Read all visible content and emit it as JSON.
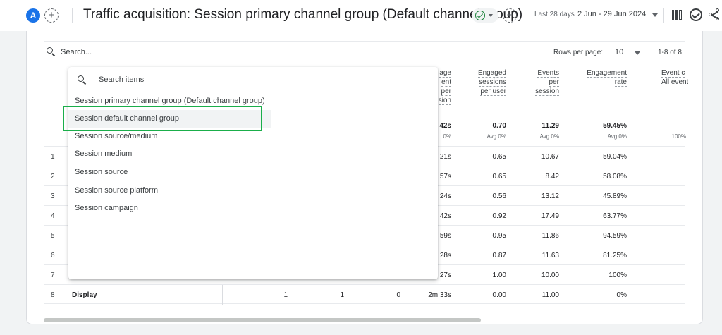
{
  "header": {
    "avatar_letter": "A",
    "title": "Traffic acquisition: Session primary channel group (Default channel group)",
    "date_label": "Last 28 days",
    "date_range": "2 Jun - 29 Jun 2024"
  },
  "table_controls": {
    "search_placeholder": "Search...",
    "rows_per_page_label": "Rows per page:",
    "rows_per_page_value": "10",
    "page_count": "1-8 of 8"
  },
  "columns": {
    "avg_engagement_time": [
      "age",
      "ent",
      "per",
      "sion"
    ],
    "engaged_sessions_per_user": [
      "Engaged",
      "sessions",
      "per user"
    ],
    "events_per_session": [
      "Events",
      "per",
      "session"
    ],
    "engagement_rate": [
      "Engagement",
      "rate"
    ],
    "event_count": [
      "Event c",
      "All event"
    ]
  },
  "totals": {
    "avg_engagement_time": "42s",
    "avg_engagement_time_sub": "0%",
    "engaged_sessions_per_user": "0.70",
    "engaged_sessions_per_user_sub": "Avg 0%",
    "events_per_session": "11.29",
    "events_per_session_sub": "Avg 0%",
    "engagement_rate": "59.45%",
    "engagement_rate_sub": "Avg 0%",
    "event_count_sub": "100%"
  },
  "rows": [
    {
      "num": "1",
      "time": "21s",
      "esu": "0.65",
      "eps": "10.67",
      "er": "59.04%"
    },
    {
      "num": "2",
      "time": "57s",
      "esu": "0.65",
      "eps": "8.42",
      "er": "58.08%"
    },
    {
      "num": "3",
      "time": "24s",
      "esu": "0.56",
      "eps": "13.12",
      "er": "45.89%"
    },
    {
      "num": "4",
      "time": "42s",
      "esu": "0.92",
      "eps": "17.49",
      "er": "63.77%"
    },
    {
      "num": "5",
      "time": "59s",
      "esu": "0.95",
      "eps": "11.86",
      "er": "94.59%"
    },
    {
      "num": "6",
      "time": "28s",
      "esu": "0.87",
      "eps": "11.63",
      "er": "81.25%"
    },
    {
      "num": "7",
      "time": "27s",
      "esu": "1.00",
      "eps": "10.00",
      "er": "100%"
    },
    {
      "num": "8",
      "name": "Display",
      "c1": "1",
      "c2": "1",
      "c3": "0",
      "time": "2m 33s",
      "esu": "0.00",
      "eps": "11.00",
      "er": "0%"
    }
  ],
  "dropdown": {
    "search_placeholder": "Search items",
    "items": [
      "Session primary channel group (Default channel group)",
      "Session default channel group",
      "Session source/medium",
      "Session medium",
      "Session source",
      "Session source platform",
      "Session campaign"
    ]
  },
  "colors": {
    "accent": "#1a73e8",
    "highlight_box": "#1aae4a",
    "check": "#188038"
  }
}
